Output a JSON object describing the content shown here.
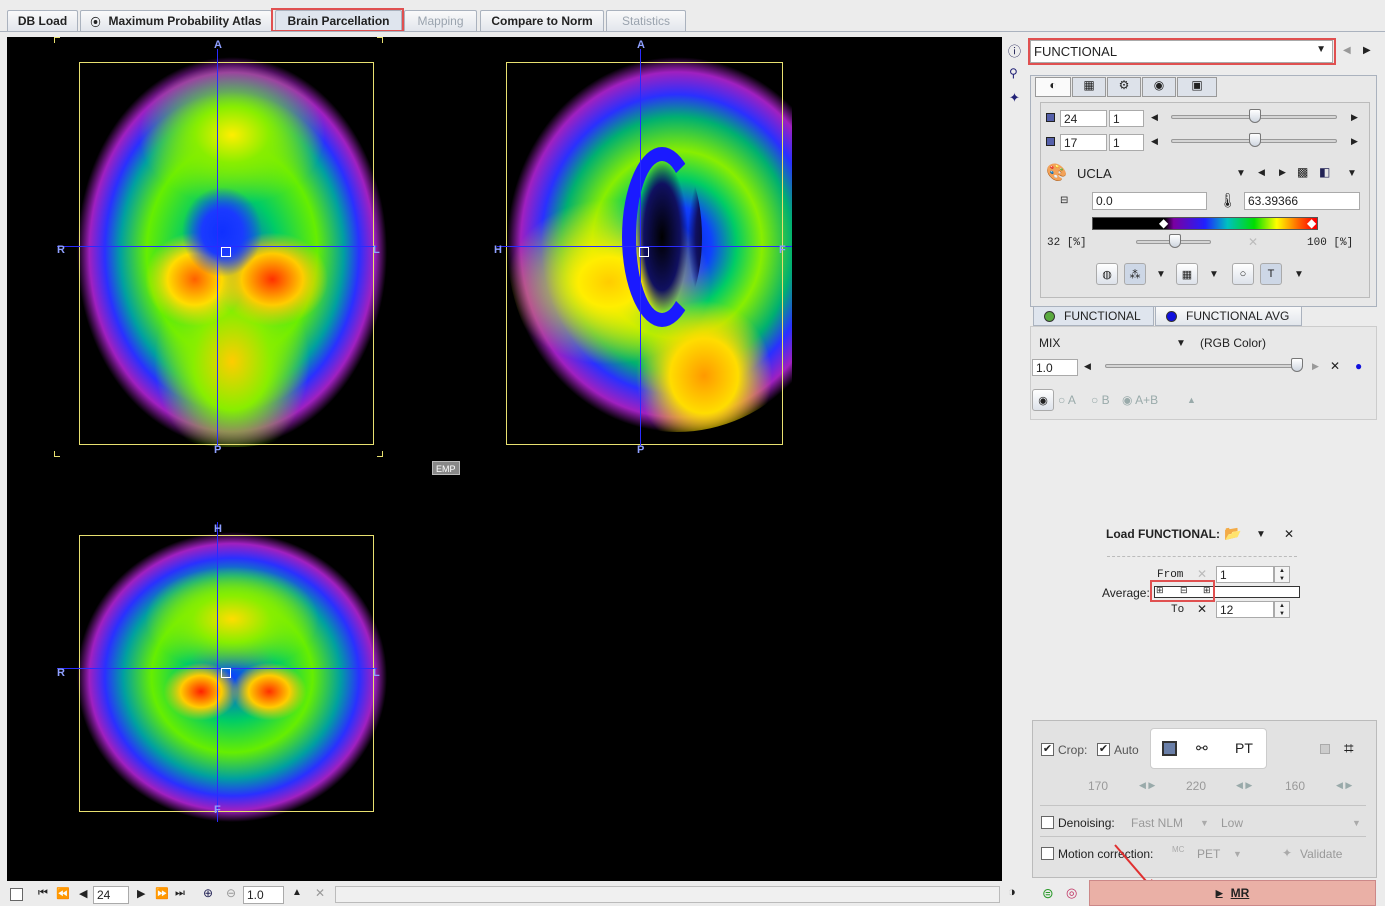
{
  "tabs": [
    {
      "label": "DB Load"
    },
    {
      "label": "Maximum Probability Atlas"
    },
    {
      "label": "Brain Parcellation"
    },
    {
      "label": "Mapping"
    },
    {
      "label": "Compare to Norm"
    },
    {
      "label": "Statistics"
    }
  ],
  "viewer": {
    "axial": {
      "top": "A",
      "bottom": "P",
      "left": "R",
      "right": "L"
    },
    "sagittal": {
      "top": "A",
      "bottom": "P",
      "left": "H",
      "right": "F"
    },
    "coronal": {
      "top": "H",
      "bottom": "F",
      "left": "R",
      "right": "L"
    },
    "emp_badge": "EMP"
  },
  "bottom_toolbar": {
    "slice": "24",
    "zoom": "1.0"
  },
  "panel": {
    "series_select": "FUNCTIONAL",
    "slice1": {
      "value": "24",
      "step": "1"
    },
    "slice2": {
      "value": "17",
      "step": "1"
    },
    "colortable": "UCLA",
    "min_value": "0.0",
    "max_value": "63.39366",
    "lower_pct": "32  [%]",
    "upper_pct": "100  [%]",
    "series_tabs": [
      "FUNCTIONAL",
      "FUNCTIONAL AVG"
    ],
    "mix_label": "MIX",
    "mix_mode": "(RGB Color)",
    "mix_value": "1.0",
    "radio": [
      "A",
      "B",
      "A+B"
    ],
    "load_label": "Load FUNCTIONAL:",
    "from_label": "From",
    "from_value": "1",
    "average_label": "Average:",
    "to_label": "To",
    "to_value": "12",
    "crop_label": "Crop:",
    "auto_label": "Auto",
    "pt_label": "PT",
    "crop_sizes": [
      "170",
      "220",
      "160"
    ],
    "denoising_label": "Denoising:",
    "denoise_method": "Fast NLM",
    "denoise_level": "Low",
    "motion_label": "Motion correction:",
    "motion_ref": "PET",
    "validate_label": "Validate",
    "mr_button": "MR"
  },
  "colors": {
    "accent_red": "#e05050",
    "mr_button_bg": "#eab0a6",
    "crosshair": "#2a2aff",
    "bbox": "#e8e070"
  }
}
